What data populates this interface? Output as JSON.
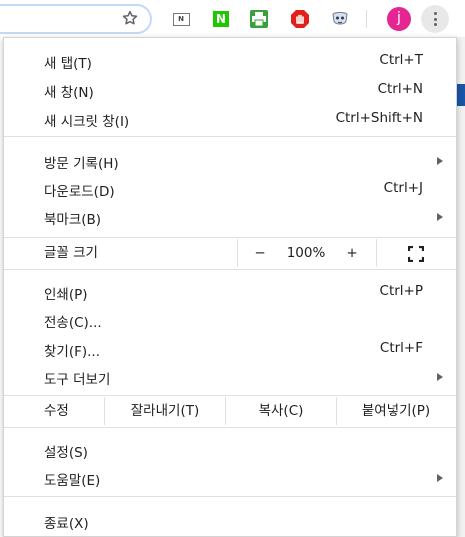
{
  "toolbar": {
    "profile_initial": "j",
    "extensions": [
      "naver-outline-n",
      "naver-green-n",
      "printer",
      "stop-hand",
      "mask"
    ],
    "ext_green_n_label": "N",
    "ext_outline_n_label": "N"
  },
  "menu": {
    "new_tab": {
      "label": "새 탭(T)",
      "shortcut": "Ctrl+T"
    },
    "new_window": {
      "label": "새 창(N)",
      "shortcut": "Ctrl+N"
    },
    "new_incognito": {
      "label": "새 시크릿 창(I)",
      "shortcut": "Ctrl+Shift+N"
    },
    "history": {
      "label": "방문 기록(H)"
    },
    "downloads": {
      "label": "다운로드(D)",
      "shortcut": "Ctrl+J"
    },
    "bookmarks": {
      "label": "북마크(B)"
    },
    "zoom": {
      "label": "글꼴 크기",
      "minus": "−",
      "value": "100%",
      "plus": "+"
    },
    "print": {
      "label": "인쇄(P)",
      "shortcut": "Ctrl+P"
    },
    "cast": {
      "label": "전송(C)..."
    },
    "find": {
      "label": "찾기(F)...",
      "shortcut": "Ctrl+F"
    },
    "more_tools": {
      "label": "도구 더보기"
    },
    "edit": {
      "label": "수정",
      "cut": "잘라내기(T)",
      "copy": "복사(C)",
      "paste": "붙여넣기(P)"
    },
    "settings": {
      "label": "설정(S)"
    },
    "help": {
      "label": "도움말(E)"
    },
    "exit": {
      "label": "종료(X)"
    }
  },
  "colors": {
    "accent": "#1a73e8",
    "avatar": "#e52592",
    "page_blue": "#1a56a8"
  }
}
